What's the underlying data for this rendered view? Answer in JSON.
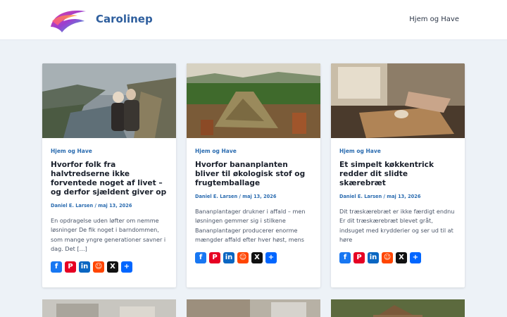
{
  "site": {
    "title": "Carolinep"
  },
  "nav": {
    "items": [
      {
        "label": "Hjem og Have"
      }
    ]
  },
  "posts": [
    {
      "category": "Hjem og Have",
      "title": "Hvorfor folk fra halvtredserne ikke forventede noget af livet – og derfor sjældent giver op",
      "author": "Daniel E. Larsen",
      "date": "maj 13, 2026",
      "excerpt": "En opdragelse uden løfter om nemme løsninger De fik noget i barndommen, som mange yngre generationer savner i dag. Det […]"
    },
    {
      "category": "Hjem og Have",
      "title": "Hvorfor bananplanten bliver til økologisk stof og frugtemballage",
      "author": "Daniel E. Larsen",
      "date": "maj 13, 2026",
      "excerpt": "Bananplantager drukner i affald – men løsningen gemmer sig i stilkene Bananplantager producerer enorme mængder affald efter hver høst, mens"
    },
    {
      "category": "Hjem og Have",
      "title": "Et simpelt køkkentrick redder dit slidte skærebræt",
      "author": "Daniel E. Larsen",
      "date": "maj 13, 2026",
      "excerpt": "Dit træskærebræt er ikke færdigt endnu Er dit træskærebræt blevet gråt, indsuget med krydderier og ser ud til at høre"
    }
  ],
  "share_icons": [
    "facebook-icon",
    "pinterest-icon",
    "linkedin-icon",
    "reddit-icon",
    "x-icon",
    "share-icon"
  ],
  "colors": {
    "accent": "#2b6cb0",
    "title": "#2f5f9e",
    "background": "#edf2f7"
  }
}
